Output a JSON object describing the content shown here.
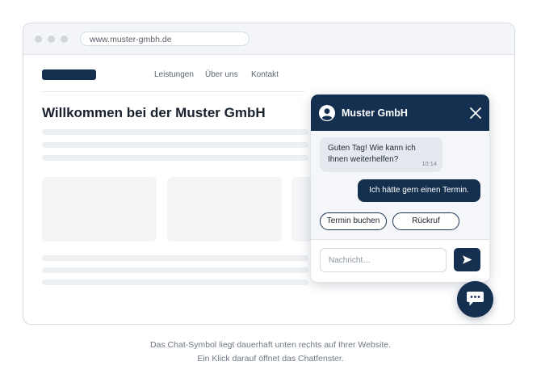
{
  "browser": {
    "url": "www.muster-gmbh.de"
  },
  "website": {
    "nav": {
      "items": [
        "Leistungen",
        "Über uns",
        "Kontakt"
      ]
    },
    "title": "Willkommen bei der Muster GmbH"
  },
  "chat": {
    "title": "Muster GmbH",
    "messages": [
      {
        "from": "bot",
        "text": "Guten Tag! Wie kann ich Ihnen weiterhelfen?",
        "time": "10:14"
      },
      {
        "from": "user",
        "text": "Ich hätte gern einen Termin."
      }
    ],
    "quick_replies": [
      "Termin buchen",
      "Rückruf"
    ],
    "input": {
      "value": "",
      "placeholder": "Nachricht…"
    },
    "send_icon": "send-arrow-icon",
    "close_icon": "close-icon",
    "avatar_icon": "user-avatar-icon"
  },
  "launcher": {
    "icon": "chat-bubble-icon"
  },
  "caption": {
    "line1": "Das Chat-Symbol liegt dauerhaft unten rechts auf Ihrer Website.",
    "line2": "Ein Klick darauf öffnet das Chatfenster."
  },
  "colors": {
    "brand_navy": "#142f4f",
    "page_bg": "#ffffff",
    "skeleton": "#edf0f3",
    "bubble_in": "#e5e9ef"
  }
}
